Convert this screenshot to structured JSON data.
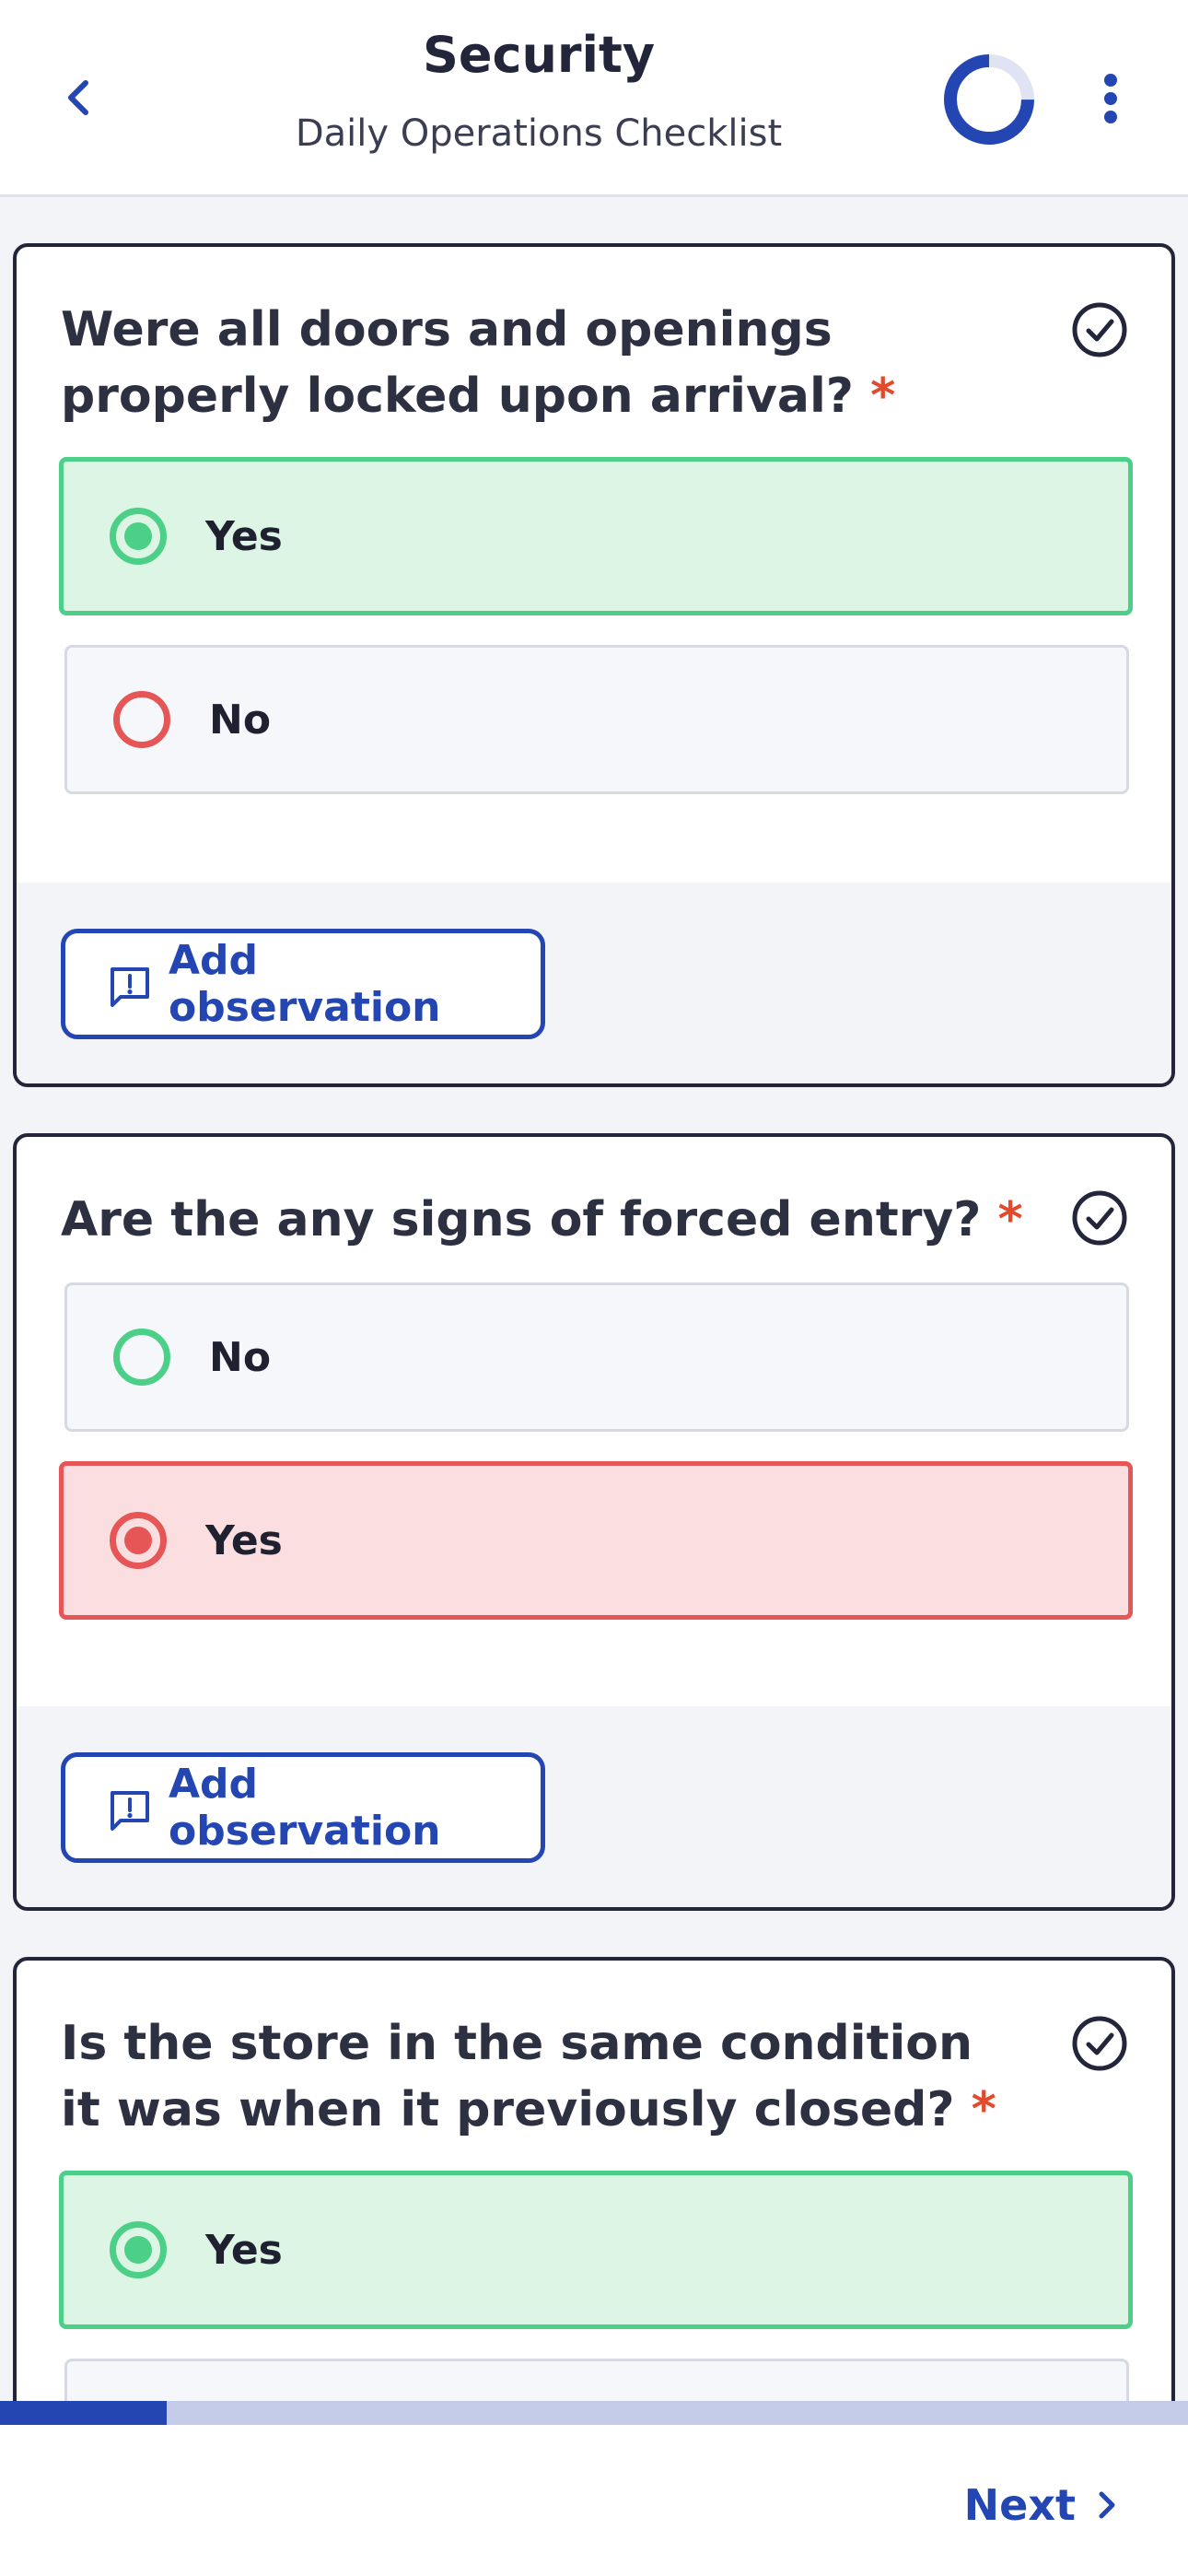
{
  "header": {
    "title": "Security",
    "subtitle": "Daily Operations Checklist",
    "completion_fraction": 0.25
  },
  "questions": [
    {
      "text": "Were all doors and openings properly locked upon arrival?",
      "required_mark": "*",
      "options": [
        {
          "label": "Yes",
          "selected": true,
          "color": "#4ccf86"
        },
        {
          "label": "No",
          "selected": false,
          "color": "#e65656"
        }
      ],
      "add_observation_label": "Add observation"
    },
    {
      "text": "Are the any signs of forced entry?",
      "required_mark": "*",
      "options": [
        {
          "label": "No",
          "selected": false,
          "color": "#4ccf86"
        },
        {
          "label": "Yes",
          "selected": true,
          "color": "#e65656"
        }
      ],
      "add_observation_label": "Add observation"
    },
    {
      "text": "Is the store in the same condition it was when it previously closed?",
      "required_mark": "*",
      "options": [
        {
          "label": "Yes",
          "selected": true,
          "color": "#4ccf86"
        }
      ]
    }
  ],
  "progress": {
    "fraction": 0.14
  },
  "footer": {
    "next_label": "Next"
  },
  "colors": {
    "accent": "#2346b3",
    "green": "#4ccf86",
    "red": "#e65656",
    "required": "#e34a2b"
  },
  "icons": [
    "back-chevron-icon",
    "progress-ring-icon",
    "more-vertical-icon",
    "check-circle-icon",
    "comment-alert-icon",
    "chevron-right-icon"
  ]
}
